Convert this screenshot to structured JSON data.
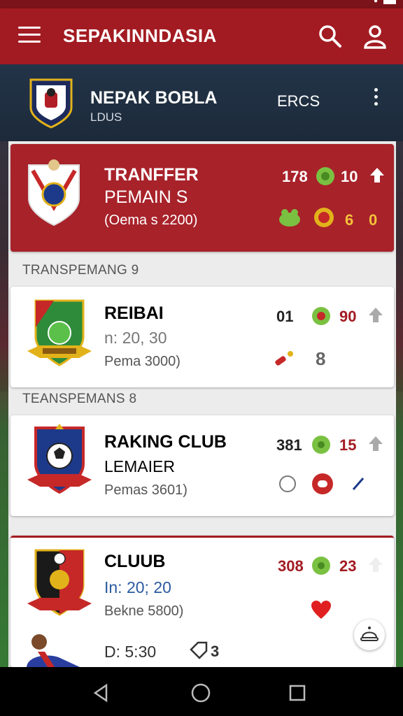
{
  "status": {
    "right_text": "ᐧ",
    "time": ""
  },
  "appbar": {
    "title": "SEPAKINNDASIA"
  },
  "club_header": {
    "name": "NEPAK BOBLA",
    "subtitle": "LDUS",
    "tag": "ERCS"
  },
  "featured": {
    "line1": "TRANFFER",
    "line2": "PEMAIN S",
    "line3": "(Oema s 2200)",
    "stat1": "178",
    "stat2": "10",
    "stat3": "6",
    "stat4": "0"
  },
  "section1": {
    "label": "TRANSPEMANG 9"
  },
  "card1": {
    "line1": "REIBAI",
    "line2": "n: 20, 30",
    "line3": "Pema 3000)",
    "stat1": "01",
    "stat2": "90",
    "stat3": "8"
  },
  "section2": {
    "label": "TEANSPEMANS 8"
  },
  "card2": {
    "line1": "RAKING CLUB",
    "line2": "LEMAIER",
    "line3": "Pemas 3601)",
    "stat1": "381",
    "stat2": "15"
  },
  "card3": {
    "line1": "CLUUB",
    "line2": "In: 20; 20",
    "line3": "Bekne 5800)",
    "line4": "D: 5:30",
    "stat1": "308",
    "stat2": "23",
    "stat3": "3"
  },
  "colors": {
    "brand": "#a31b22",
    "accent_green": "#7ac142",
    "gold": "#e2b21a"
  }
}
